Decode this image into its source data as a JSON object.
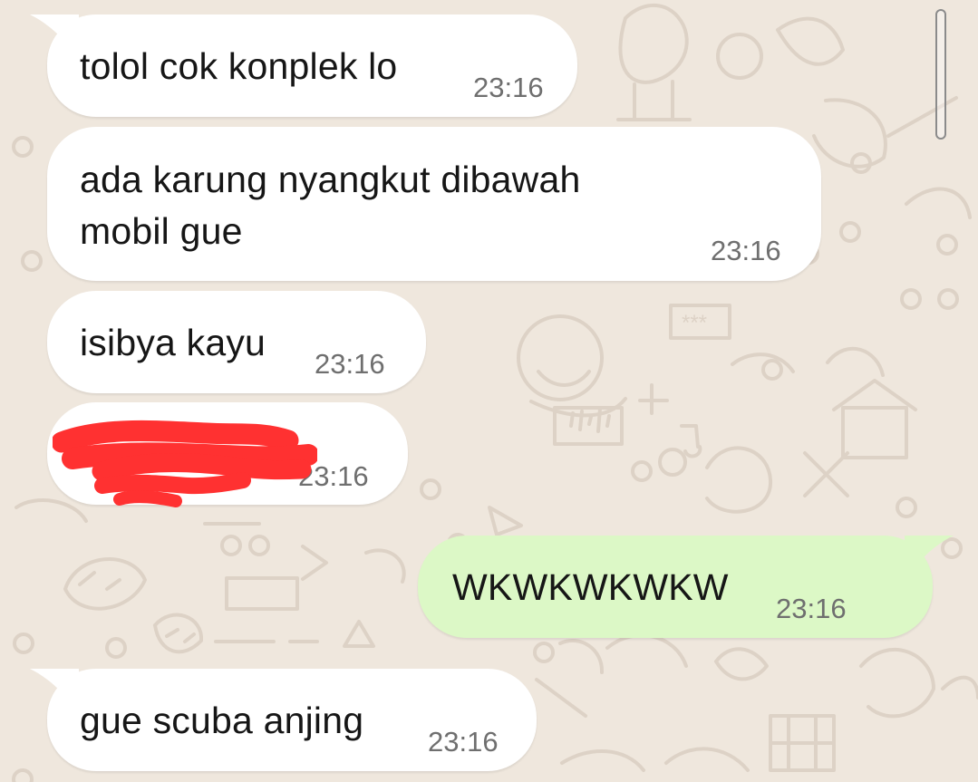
{
  "conversation": {
    "messages": [
      {
        "direction": "incoming",
        "text": "tolol cok konplek lo",
        "time": "23:16"
      },
      {
        "direction": "incoming",
        "text_lines": [
          "ada karung nyangkut dibawah",
          "mobil gue"
        ],
        "time": "23:16"
      },
      {
        "direction": "incoming",
        "text": "isibya kayu",
        "time": "23:16"
      },
      {
        "direction": "incoming",
        "text": "",
        "time": "23:16",
        "redaction": "red-scribble"
      },
      {
        "direction": "outgoing",
        "text": "WKWKWKWKW",
        "time": "23:16",
        "status_icon": "double-check-icon"
      },
      {
        "direction": "incoming",
        "text": "gue scuba anjing",
        "time": "23:16"
      }
    ]
  },
  "colors": {
    "chat_background": "#efe7dd",
    "incoming_bubble": "#ffffff",
    "outgoing_bubble": "#dcf8c6",
    "redaction": "#ff3131"
  },
  "icons": {
    "read_status": "double-check-icon",
    "scrollbar": "scrollbar-thumb",
    "background": "chat-doodle-wallpaper"
  }
}
